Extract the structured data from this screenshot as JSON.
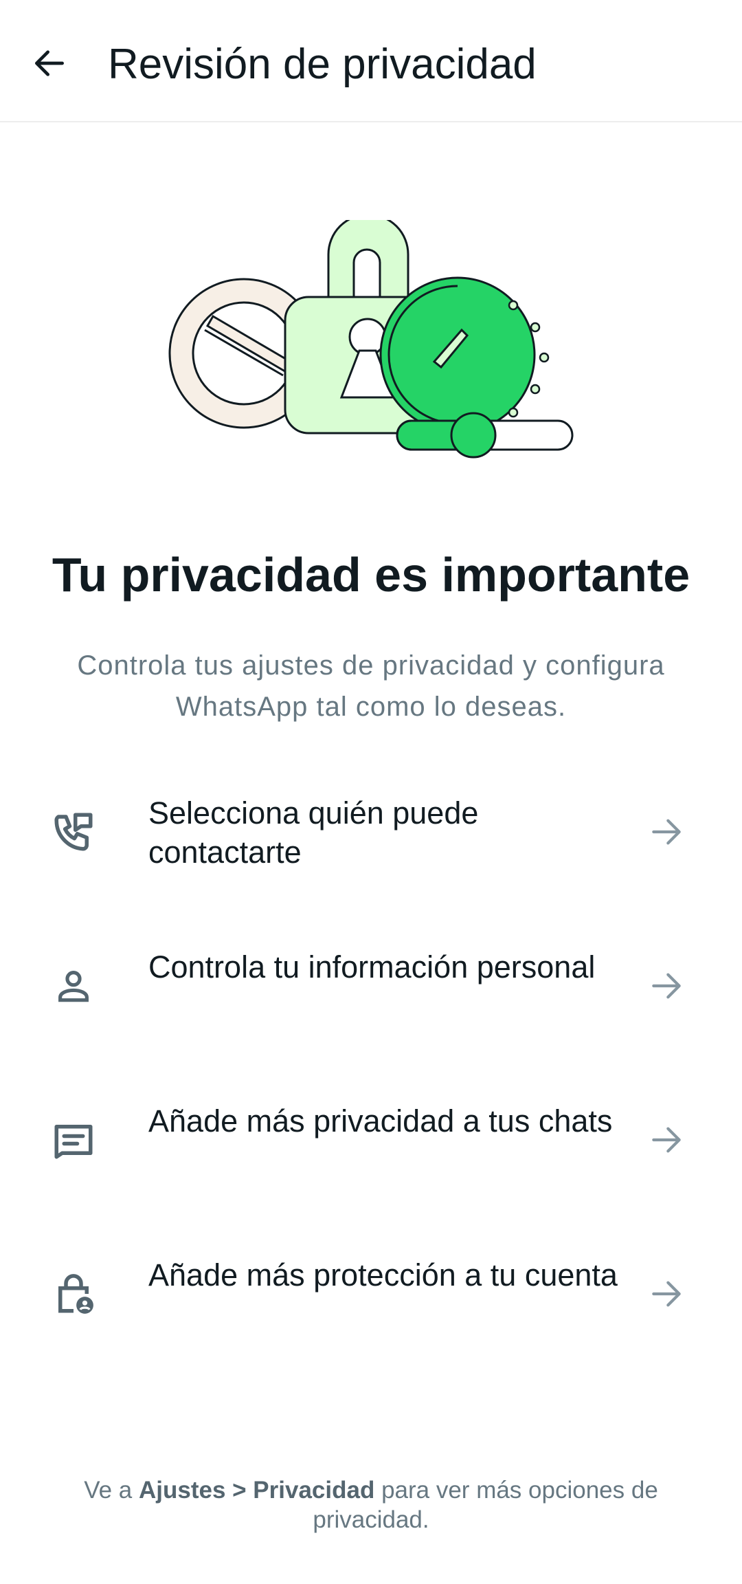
{
  "header": {
    "title": "Revisión de privacidad",
    "back_icon": "arrow-left-icon"
  },
  "illustration": {
    "icon": "privacy-illustration",
    "colors": {
      "green": "#25d366",
      "light_green": "#d9fdd3",
      "cream": "#f7efe6"
    }
  },
  "main": {
    "headline": "Tu privacidad es importante",
    "subtitle": "Controla tus ajustes de privacidad y configura WhatsApp tal como lo deseas."
  },
  "options": [
    {
      "label": "Selecciona quién puede contactarte",
      "icon": "phone-chat-icon"
    },
    {
      "label": "Controla tu información personal",
      "icon": "person-icon"
    },
    {
      "label": "Añade más privacidad a tus chats",
      "icon": "chat-message-icon"
    },
    {
      "label": "Añade más protección a tu cuenta",
      "icon": "lock-account-icon"
    }
  ],
  "footer": {
    "prefix": "Ve a ",
    "path": "Ajustes > Privacidad",
    "suffix": " para ver más opciones de privacidad."
  }
}
